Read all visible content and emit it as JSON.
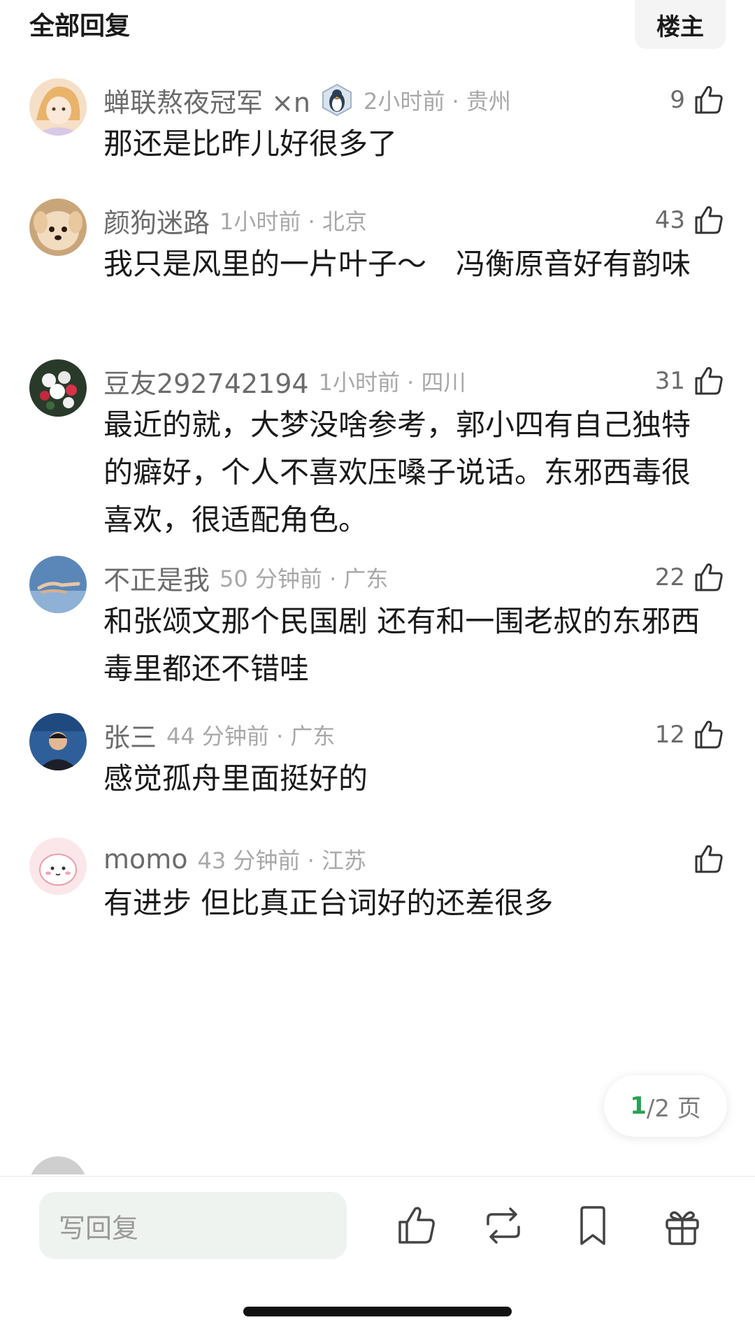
{
  "header": {
    "title": "全部回复",
    "op_label": "楼主"
  },
  "comments": [
    {
      "username": "蝉联熬夜冠军 ×n",
      "time_location": "2小时前 · 贵州",
      "likes": "9",
      "text": "那还是比昨儿好很多了"
    },
    {
      "username": "颜狗迷路",
      "time_location": "1小时前 · 北京",
      "likes": "43",
      "text": "我只是风里的一片叶子～　冯衡原音好有韵味"
    },
    {
      "username": "豆友292742194",
      "time_location": "1小时前 · 四川",
      "likes": "31",
      "text": "最近的就，大梦没啥参考，郭小四有自己独特的癖好，个人不喜欢压嗓子说话。东邪西毒很喜欢，很适配角色。"
    },
    {
      "username": "不正是我",
      "time_location": "50 分钟前 · 广东",
      "likes": "22",
      "text": "和张颂文那个民国剧 还有和一围老叔的东邪西毒里都还不错哇"
    },
    {
      "username": "张三",
      "time_location": "44 分钟前 · 广东",
      "likes": "12",
      "text": "感觉孤舟里面挺好的"
    },
    {
      "username": "momo",
      "time_location": "43 分钟前 · 江苏",
      "likes": "",
      "text": "有进步 但比真正台词好的还差很多"
    }
  ],
  "pagination": {
    "current": "1",
    "total_suffix": "/2 页"
  },
  "bottom_bar": {
    "reply_placeholder": "写回复"
  },
  "icons": {
    "like": "thumbs-up-icon",
    "repost": "repost-icon",
    "bookmark": "bookmark-icon",
    "gift": "gift-icon"
  },
  "colors": {
    "accent_green": "#2aa055",
    "input_bg": "#eef3ef",
    "meta_gray": "#a8a8a8"
  }
}
